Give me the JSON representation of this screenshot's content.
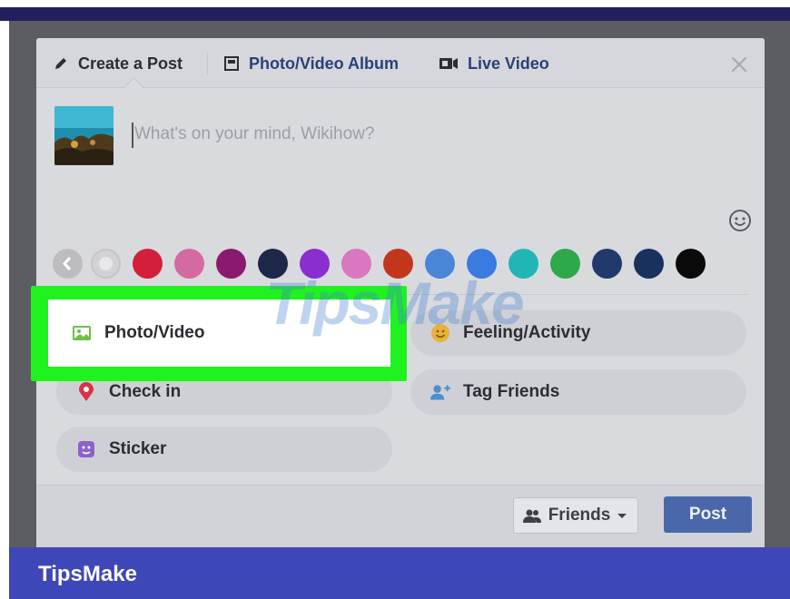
{
  "tabs": {
    "create_post": "Create a Post",
    "photo_album": "Photo/Video Album",
    "live_video": "Live Video"
  },
  "composer": {
    "placeholder": "What's on your mind, Wikihow?"
  },
  "background_colors": [
    "#c9c9cc",
    "#d8d8dc",
    "#d21f3a",
    "#d46aa0",
    "#8b1a6e",
    "#1d2747",
    "#8a2ed0",
    "#d977c0",
    "#c2371c",
    "#4a86d8",
    "#3a7be0",
    "#22b5b5",
    "#2ea84a",
    "#1f3a6a",
    "#18315d",
    "#0a0a0a"
  ],
  "actions": {
    "photo_video": "Photo/Video",
    "feeling": "Feeling/Activity",
    "check_in": "Check in",
    "tag_friends": "Tag Friends",
    "sticker": "Sticker"
  },
  "footer": {
    "audience": "Friends",
    "post": "Post"
  },
  "watermark": "TipsMake",
  "brand": "TipsMake",
  "colors": {
    "highlight": "#1ff21f",
    "post_button": "#4a67a9",
    "brand_bar": "#3e47b8"
  }
}
